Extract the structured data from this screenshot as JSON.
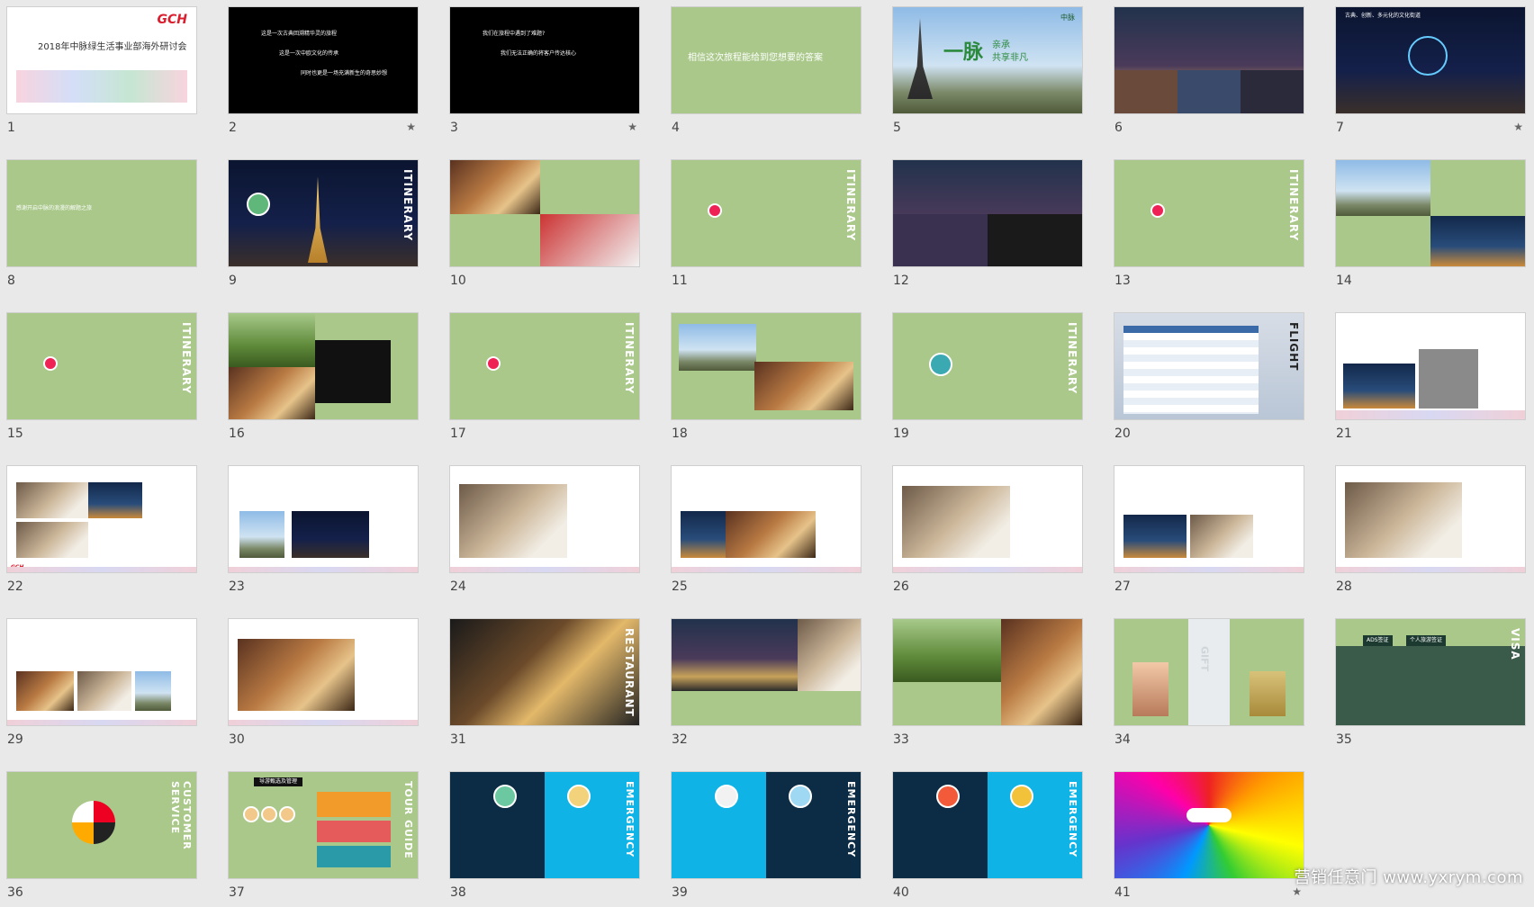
{
  "slides": [
    {
      "n": "1",
      "star": "",
      "lines": [
        "2018年中脉绿生活事业部海外研讨会",
        "GCH"
      ]
    },
    {
      "n": "2",
      "star": "★",
      "lines": [
        "这是一次古典回溯精华灵的旅程",
        "这是一次中欧文化的传承",
        "同时也更是一场充满新生的奇思妙想"
      ]
    },
    {
      "n": "3",
      "star": "★",
      "lines": [
        "我们在旅程中遇到了难题?",
        "我们无法正确的将客户传达核心"
      ]
    },
    {
      "n": "4",
      "star": "",
      "lines": [
        "相信这次旅程能给到您想要的答案"
      ]
    },
    {
      "n": "5",
      "star": "",
      "lines": [
        "一脉",
        "亲承",
        "共享非凡",
        "中脉"
      ]
    },
    {
      "n": "6",
      "star": "",
      "lines": []
    },
    {
      "n": "7",
      "star": "★",
      "lines": [
        "古典、创新、多元化的文化街道"
      ]
    },
    {
      "n": "8",
      "star": "",
      "lines": [
        "感谢开启中脉的浪漫的解题之旅"
      ]
    },
    {
      "n": "9",
      "star": "",
      "lines": [
        "ITINERARY"
      ]
    },
    {
      "n": "10",
      "star": "",
      "lines": []
    },
    {
      "n": "11",
      "star": "",
      "lines": [
        "ITINERARY"
      ]
    },
    {
      "n": "12",
      "star": "",
      "lines": []
    },
    {
      "n": "13",
      "star": "",
      "lines": [
        "ITINERARY"
      ]
    },
    {
      "n": "14",
      "star": "",
      "lines": []
    },
    {
      "n": "15",
      "star": "",
      "lines": [
        "ITINERARY"
      ]
    },
    {
      "n": "16",
      "star": "",
      "lines": []
    },
    {
      "n": "17",
      "star": "",
      "lines": [
        "ITINERARY"
      ]
    },
    {
      "n": "18",
      "star": "",
      "lines": []
    },
    {
      "n": "19",
      "star": "",
      "lines": [
        "ITINERARY"
      ]
    },
    {
      "n": "20",
      "star": "",
      "lines": [
        "FLIGHT"
      ]
    },
    {
      "n": "21",
      "star": "",
      "lines": []
    },
    {
      "n": "22",
      "star": "",
      "lines": []
    },
    {
      "n": "23",
      "star": "",
      "lines": []
    },
    {
      "n": "24",
      "star": "",
      "lines": []
    },
    {
      "n": "25",
      "star": "",
      "lines": []
    },
    {
      "n": "26",
      "star": "",
      "lines": []
    },
    {
      "n": "27",
      "star": "",
      "lines": []
    },
    {
      "n": "28",
      "star": "",
      "lines": []
    },
    {
      "n": "29",
      "star": "",
      "lines": []
    },
    {
      "n": "30",
      "star": "",
      "lines": []
    },
    {
      "n": "31",
      "star": "",
      "lines": [
        "RESTAURANT"
      ]
    },
    {
      "n": "32",
      "star": "",
      "lines": []
    },
    {
      "n": "33",
      "star": "",
      "lines": []
    },
    {
      "n": "34",
      "star": "",
      "lines": [
        "GIFT"
      ]
    },
    {
      "n": "35",
      "star": "",
      "lines": [
        "VISA",
        "ADS签证",
        "个人旅游签证"
      ]
    },
    {
      "n": "36",
      "star": "",
      "lines": [
        "CUSTOMER SERVICE"
      ]
    },
    {
      "n": "37",
      "star": "",
      "lines": [
        "TOUR GUIDE",
        "导游甄选及管理"
      ]
    },
    {
      "n": "38",
      "star": "",
      "lines": [
        "EMERGENCY"
      ]
    },
    {
      "n": "39",
      "star": "",
      "lines": [
        "EMERGENCY"
      ]
    },
    {
      "n": "40",
      "star": "",
      "lines": [
        "EMERGENCY"
      ]
    },
    {
      "n": "41",
      "star": "★",
      "lines": []
    }
  ],
  "watermark": "营销任意门 www.yxrym.com"
}
